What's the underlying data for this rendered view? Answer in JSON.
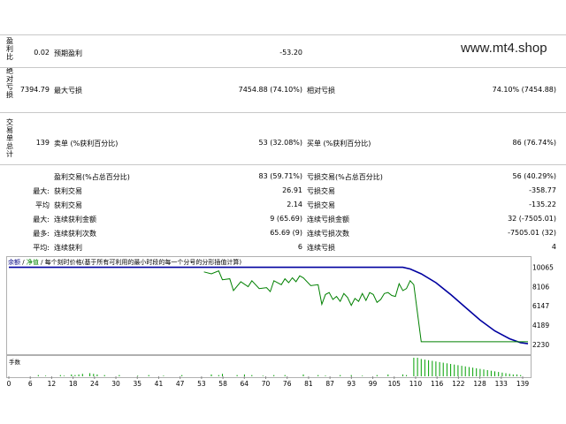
{
  "watermark": "www.mt4.shop",
  "side_labels": {
    "profit_factor": "盈利比",
    "absolute_drawdown": "绝对亏损",
    "total_trades": "交易单总计"
  },
  "row1": {
    "left_value": "0.02",
    "label": "预期盈利",
    "value": "-53.20"
  },
  "row2": {
    "left_value": "7394.79",
    "label": "最大亏损",
    "value": "7454.88 (74.10%)",
    "right_label": "相对亏损",
    "right_value": "74.10% (7454.88)"
  },
  "row3": {
    "left_value": "139",
    "label": "卖单 (%获利百分比)",
    "value": "53 (32.08%)",
    "right_label": "买单 (%获利百分比)",
    "right_value": "86 (76.74%)"
  },
  "stats": [
    {
      "prefix": "",
      "label": "盈利交易(%占总百分比)",
      "value": "83 (59.71%)",
      "right_label": "亏损交易(%占总百分比)",
      "right_value": "56 (40.29%)"
    },
    {
      "prefix": "最大:",
      "label": "获利交易",
      "value": "26.91",
      "right_label": "亏损交易",
      "right_value": "-358.77"
    },
    {
      "prefix": "平均",
      "label": "获利交易",
      "value": "2.14",
      "right_label": "亏损交易",
      "right_value": "-135.22"
    },
    {
      "prefix": "最大:",
      "label": "连续获利金额",
      "value": "9 (65.69)",
      "right_label": "连续亏损金额",
      "right_value": "32 (-7505.01)"
    },
    {
      "prefix": "最多:",
      "label": "连续获利次数",
      "value": "65.69 (9)",
      "right_label": "连续亏损次数",
      "right_value": "-7505.01 (32)"
    },
    {
      "prefix": "平均:",
      "label": "连续获利",
      "value": "6",
      "right_label": "连续亏损",
      "right_value": "4"
    }
  ],
  "chart_legend": {
    "balance": "余额",
    "sep": "/",
    "equity": "净值",
    "rest": "/ 每个刻时价格(基于所有可利用的最小时段的每一个分号的分形插值计算)"
  },
  "volume_label": "手数",
  "colors": {
    "balance": "#0000a0",
    "equity": "#008000",
    "volume": "#00a000"
  },
  "chart_data": {
    "type": "line",
    "x_ticks": [
      "0",
      "6",
      "12",
      "18",
      "24",
      "30",
      "35",
      "41",
      "47",
      "53",
      "58",
      "64",
      "70",
      "76",
      "81",
      "87",
      "93",
      "99",
      "105",
      "110",
      "116",
      "122",
      "128",
      "133",
      "139"
    ],
    "y_ticks": [
      "10065",
      "8106",
      "6147",
      "4189",
      "2230"
    ],
    "ylim": [
      1500,
      10300
    ],
    "xlim": [
      0,
      141
    ],
    "series": [
      {
        "name": "余额",
        "x": [
          0,
          53,
          60,
          70,
          80,
          90,
          100,
          107,
          109,
          112,
          116,
          120,
          124,
          128,
          132,
          136,
          139,
          141
        ],
        "y": [
          10065,
          10065,
          10065,
          10065,
          10065,
          10065,
          10065,
          10065,
          9900,
          9400,
          8500,
          7300,
          6000,
          4700,
          3600,
          2800,
          2400,
          2300
        ]
      },
      {
        "name": "净值",
        "x": [
          53,
          55,
          57,
          58,
          60,
          61,
          63,
          65,
          66,
          68,
          70,
          71,
          72,
          74,
          75,
          76,
          77,
          78,
          79,
          80,
          82,
          84,
          85,
          86,
          87,
          88,
          89,
          90,
          91,
          92,
          93,
          94,
          95,
          96,
          97,
          98,
          99,
          100,
          101,
          102,
          103,
          104,
          105,
          106,
          107,
          108,
          109,
          110,
          112,
          116,
          120,
          124,
          128,
          132,
          136,
          139,
          141
        ],
        "y": [
          9600,
          9400,
          9700,
          8800,
          8900,
          7700,
          8600,
          8100,
          8700,
          7900,
          8000,
          7600,
          8700,
          8300,
          8900,
          8500,
          9000,
          8600,
          9200,
          9000,
          8200,
          8300,
          6300,
          7300,
          7500,
          6800,
          7100,
          6600,
          7400,
          7000,
          6200,
          6900,
          6600,
          7400,
          6700,
          7500,
          7300,
          6500,
          6800,
          7400,
          7500,
          7200,
          7100,
          8400,
          7700,
          7900,
          8700,
          8300,
          2500,
          2500,
          2500,
          2500,
          2500,
          2500,
          2500,
          2500,
          2500
        ]
      }
    ],
    "volume": {
      "name": "手数",
      "x": [
        8,
        10,
        14,
        15,
        17,
        18,
        19,
        20,
        22,
        23,
        24,
        26,
        30,
        35,
        38,
        42,
        47,
        55,
        57,
        58,
        62,
        64,
        66,
        69,
        72,
        75,
        80,
        84,
        86,
        90,
        93,
        96,
        100,
        103,
        107,
        108,
        110,
        111,
        112,
        113,
        114,
        115,
        116,
        117,
        118,
        119,
        120,
        121,
        122,
        123,
        124,
        125,
        126,
        127,
        128,
        129,
        130,
        131,
        132,
        133,
        134,
        135,
        136,
        137,
        138,
        139
      ],
      "y": [
        2,
        1,
        2,
        1,
        3,
        2,
        3,
        4,
        5,
        4,
        3,
        2,
        2,
        1,
        2,
        1,
        2,
        3,
        2,
        4,
        2,
        3,
        2,
        1,
        2,
        2,
        3,
        2,
        1,
        2,
        2,
        1,
        2,
        3,
        3,
        2,
        30,
        30,
        28,
        27,
        26,
        25,
        24,
        23,
        22,
        21,
        20,
        19,
        18,
        17,
        16,
        15,
        14,
        13,
        12,
        11,
        10,
        9,
        8,
        7,
        6,
        5,
        4,
        3,
        3,
        2
      ]
    }
  }
}
